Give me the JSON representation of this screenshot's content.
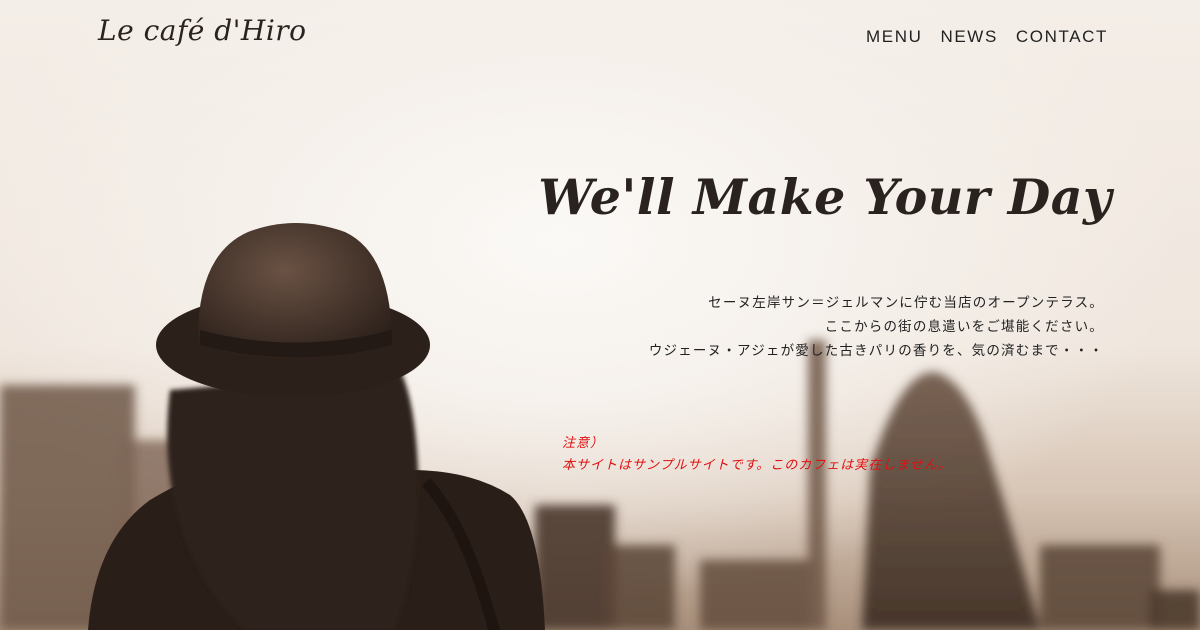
{
  "site": {
    "logo": "Le café d'Hiro"
  },
  "nav": {
    "items": [
      {
        "label": "MENU"
      },
      {
        "label": "NEWS"
      },
      {
        "label": "CONTACT"
      }
    ]
  },
  "hero": {
    "headline": "We'll Make Your Day",
    "description": [
      "セーヌ左岸サン＝ジェルマンに佇む当店のオープンテラス。",
      "ここからの街の息遣いをご堪能ください。",
      "ウジェーヌ・アジェが愛した古きパリの香りを、気の済むまで・・・"
    ],
    "notice": {
      "label": "注意）",
      "text": "本サイトはサンプルサイトです。このカフェは実在しません。"
    }
  },
  "colors": {
    "text": "#222222",
    "notice": "#e01010",
    "photo_tone": "#7a5d4a"
  }
}
